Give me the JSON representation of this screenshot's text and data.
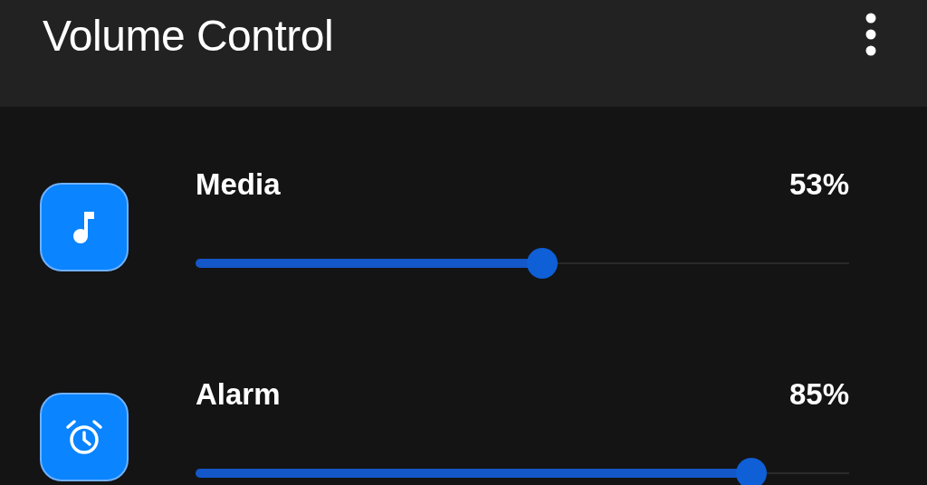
{
  "app_bar": {
    "title": "Volume Control"
  },
  "streams": [
    {
      "kind": "music",
      "name": "Media",
      "reading": "53%",
      "level": 0.53
    },
    {
      "kind": "alarm",
      "name": "Alarm",
      "reading": "85%",
      "level": 0.85
    }
  ]
}
